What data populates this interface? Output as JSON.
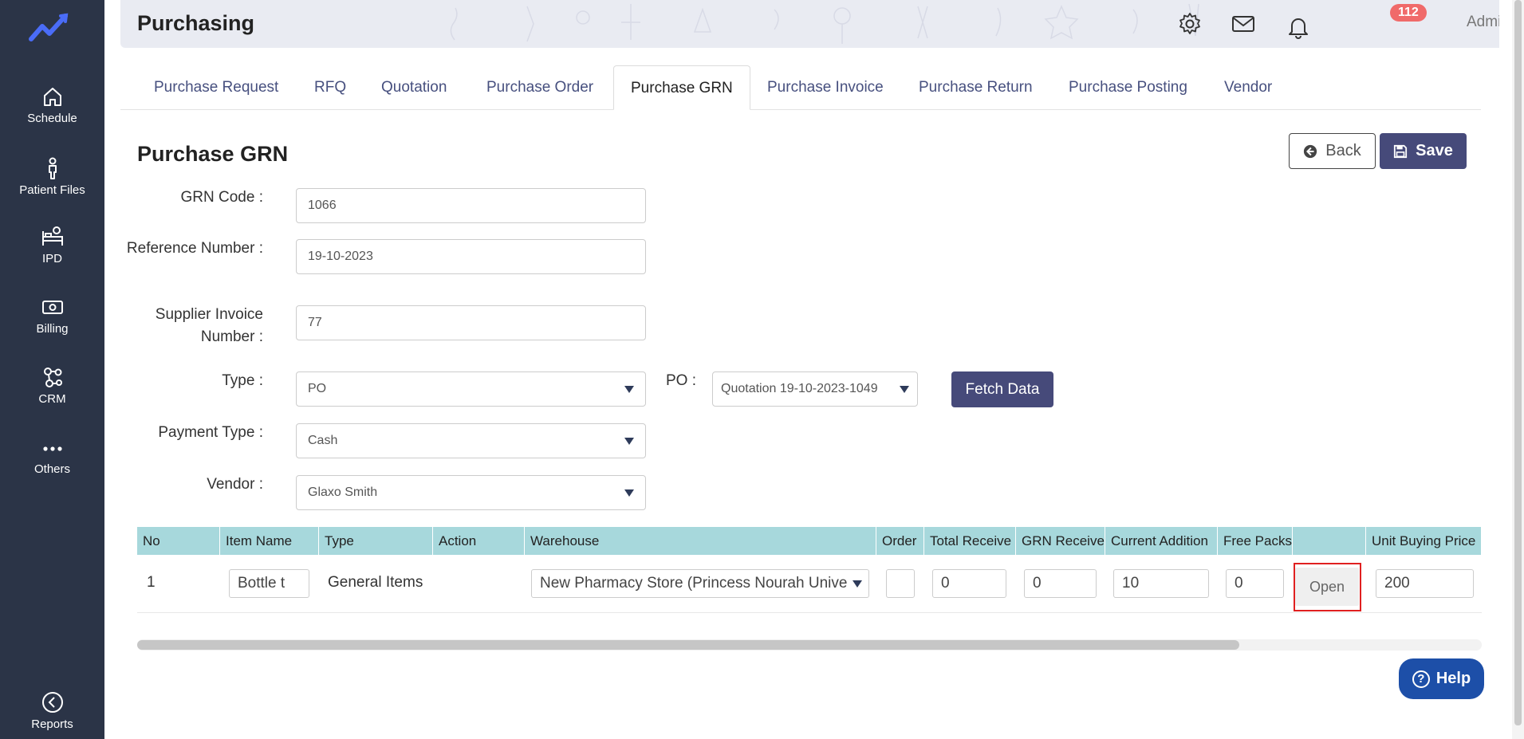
{
  "sidebar": {
    "items": [
      {
        "label": "Schedule",
        "icon": "home-icon"
      },
      {
        "label": "Patient Files",
        "icon": "person-icon"
      },
      {
        "label": "IPD",
        "icon": "bed-icon"
      },
      {
        "label": "Billing",
        "icon": "money-icon"
      },
      {
        "label": "CRM",
        "icon": "network-icon"
      },
      {
        "label": "Others",
        "icon": "more-icon"
      },
      {
        "label": "Reports",
        "icon": "back-circle-icon"
      }
    ]
  },
  "header": {
    "title": "Purchasing",
    "notification_count": "112",
    "user_name": "Administrator"
  },
  "tabs": [
    {
      "label": "Purchase Request"
    },
    {
      "label": "RFQ"
    },
    {
      "label": "Quotation"
    },
    {
      "label": "Purchase Order"
    },
    {
      "label": "Purchase GRN"
    },
    {
      "label": "Purchase Invoice"
    },
    {
      "label": "Purchase Return"
    },
    {
      "label": "Purchase Posting"
    },
    {
      "label": "Vendor"
    }
  ],
  "active_tab": "Purchase GRN",
  "form": {
    "title": "Purchase GRN",
    "back_label": "Back",
    "save_label": "Save",
    "grn_code_label": "GRN Code :",
    "grn_code": "1066",
    "reference_label": "Reference Number :",
    "reference": "19-10-2023",
    "supplier_invoice_label": "Supplier Invoice Number :",
    "supplier_invoice": "77",
    "type_label": "Type :",
    "type": "PO",
    "po_label": "PO :",
    "po": "Quotation 19-10-2023-1049",
    "fetch_label": "Fetch Data",
    "payment_type_label": "Payment Type :",
    "payment_type": "Cash",
    "vendor_label": "Vendor :",
    "vendor": "Glaxo Smith"
  },
  "table": {
    "columns": [
      "No",
      "Item Name",
      "Type",
      "Action",
      "Warehouse",
      "Order",
      "Total Receive",
      "GRN Receive",
      "Current Addition",
      "Free Packs",
      "",
      "Unit Buying Price"
    ],
    "rows": [
      {
        "no": "1",
        "item_name": "Bottle t",
        "type": "General Items",
        "action": "",
        "warehouse": "New Pharmacy Store (Princess Nourah Unive",
        "order": "",
        "total_receive": "0",
        "grn_receive": "0",
        "current_addition": "10",
        "free_packs": "0",
        "open_label": "Open",
        "unit_buying_price": "200"
      }
    ]
  },
  "help_label": "Help",
  "colors": {
    "sidebar": "#2b3447",
    "primary_button": "#464a7a",
    "table_header": "#a7d8dc",
    "badge": "#f06a6a",
    "help_button": "#1d4fa8",
    "highlight_outline": "#e02020"
  }
}
